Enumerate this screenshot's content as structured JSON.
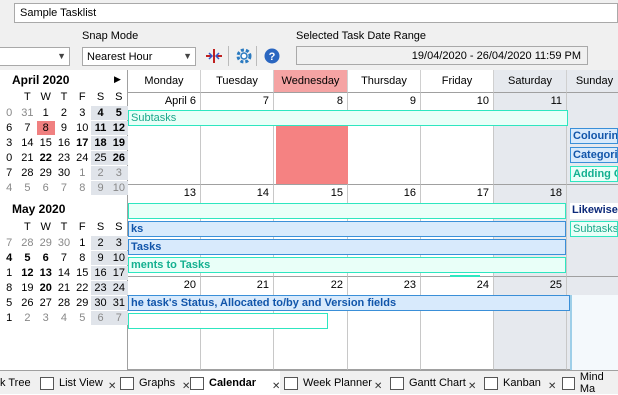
{
  "header": {
    "tasklist_name": "Sample Tasklist",
    "snap_mode_label": "Snap Mode",
    "snap_mode_value": "Nearest Hour",
    "date_range_label": "Selected Task Date Range",
    "date_range_value": "19/04/2020 - 26/04/2020 11:59 PM"
  },
  "mini_calendar": {
    "april": {
      "title": "April 2020",
      "weekday_headers": [
        "T",
        "W",
        "T",
        "F",
        "S",
        "S"
      ],
      "rows": [
        [
          "0",
          "31",
          "1",
          "2",
          "3",
          "4",
          "5"
        ],
        [
          "6",
          "7",
          "8",
          "9",
          "10",
          "11",
          "12"
        ],
        [
          "3",
          "14",
          "15",
          "16",
          "17",
          "18",
          "19"
        ],
        [
          "0",
          "21",
          "22",
          "23",
          "24",
          "25",
          "26"
        ],
        [
          "7",
          "28",
          "29",
          "30",
          "1",
          "2",
          "3"
        ],
        [
          "4",
          "5",
          "6",
          "7",
          "8",
          "9",
          "10"
        ]
      ]
    },
    "may": {
      "title": "May 2020",
      "weekday_headers": [
        "T",
        "W",
        "T",
        "F",
        "S",
        "S"
      ],
      "rows": [
        [
          "7",
          "28",
          "29",
          "30",
          "1",
          "2",
          "3"
        ],
        [
          "4",
          "5",
          "6",
          "7",
          "8",
          "9",
          "10"
        ],
        [
          "1",
          "12",
          "13",
          "14",
          "15",
          "16",
          "17"
        ],
        [
          "8",
          "19",
          "20",
          "21",
          "22",
          "23",
          "24"
        ],
        [
          "5",
          "26",
          "27",
          "28",
          "29",
          "30",
          "31"
        ],
        [
          "1",
          "2",
          "3",
          "4",
          "5",
          "6",
          "7"
        ]
      ]
    },
    "next_arrow": "▶"
  },
  "calendar": {
    "day_headers": [
      "Monday",
      "Tuesday",
      "Wednesday",
      "Thursday",
      "Friday",
      "Saturday",
      "Sunday"
    ],
    "week1": [
      "April 6",
      "7",
      "8",
      "9",
      "10",
      "11",
      ""
    ],
    "week2": [
      "13",
      "14",
      "15",
      "16",
      "17",
      "18",
      ""
    ],
    "week3": [
      "20",
      "21",
      "22",
      "23",
      "24",
      "25",
      ""
    ],
    "tasks": {
      "w1_subtasks": "Subtasks",
      "w1_colouring": "Colouring",
      "w1_categories": "Categori",
      "w1_adding": "Adding C",
      "w2_likewise": "Likewise",
      "w2_subtasks": "Subtasks",
      "w2_tasks1": "ks",
      "w2_tasks2": "Tasks",
      "w2_attach": "ments to Tasks",
      "w3_status": "he task's Status, Allocated to/by and Version fields"
    }
  },
  "tabs": [
    {
      "label": "k Tree"
    },
    {
      "label": "List View"
    },
    {
      "label": "Graphs"
    },
    {
      "label": "Calendar"
    },
    {
      "label": "Week Planner"
    },
    {
      "label": "Gantt Chart"
    },
    {
      "label": "Kanban"
    },
    {
      "label": "Mind Ma"
    }
  ],
  "colors": {
    "selected_day": "#f08080",
    "today_header": "#f5a3a3",
    "weekend": "#e6e9ee"
  }
}
